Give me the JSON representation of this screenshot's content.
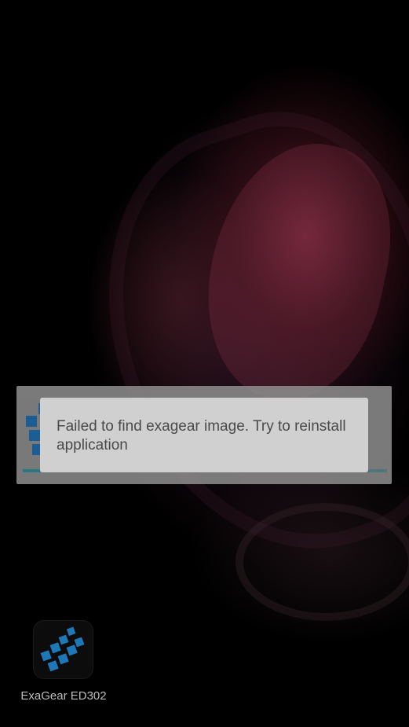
{
  "toast": {
    "message": "Failed to find exagear image. Try to reinstall application"
  },
  "progress_dialog": {
    "logo_icon": "exagear-logo-icon",
    "progress": 0.29
  },
  "home_screen": {
    "app": {
      "label": "ExaGear ED302",
      "icon": "exagear-logo-icon"
    }
  },
  "colors": {
    "toast_background": "#d0d0d0",
    "toast_text": "#4a4a4a",
    "accent_blue": "#1f6fb0",
    "progress_teal": "#2f8f9c"
  }
}
